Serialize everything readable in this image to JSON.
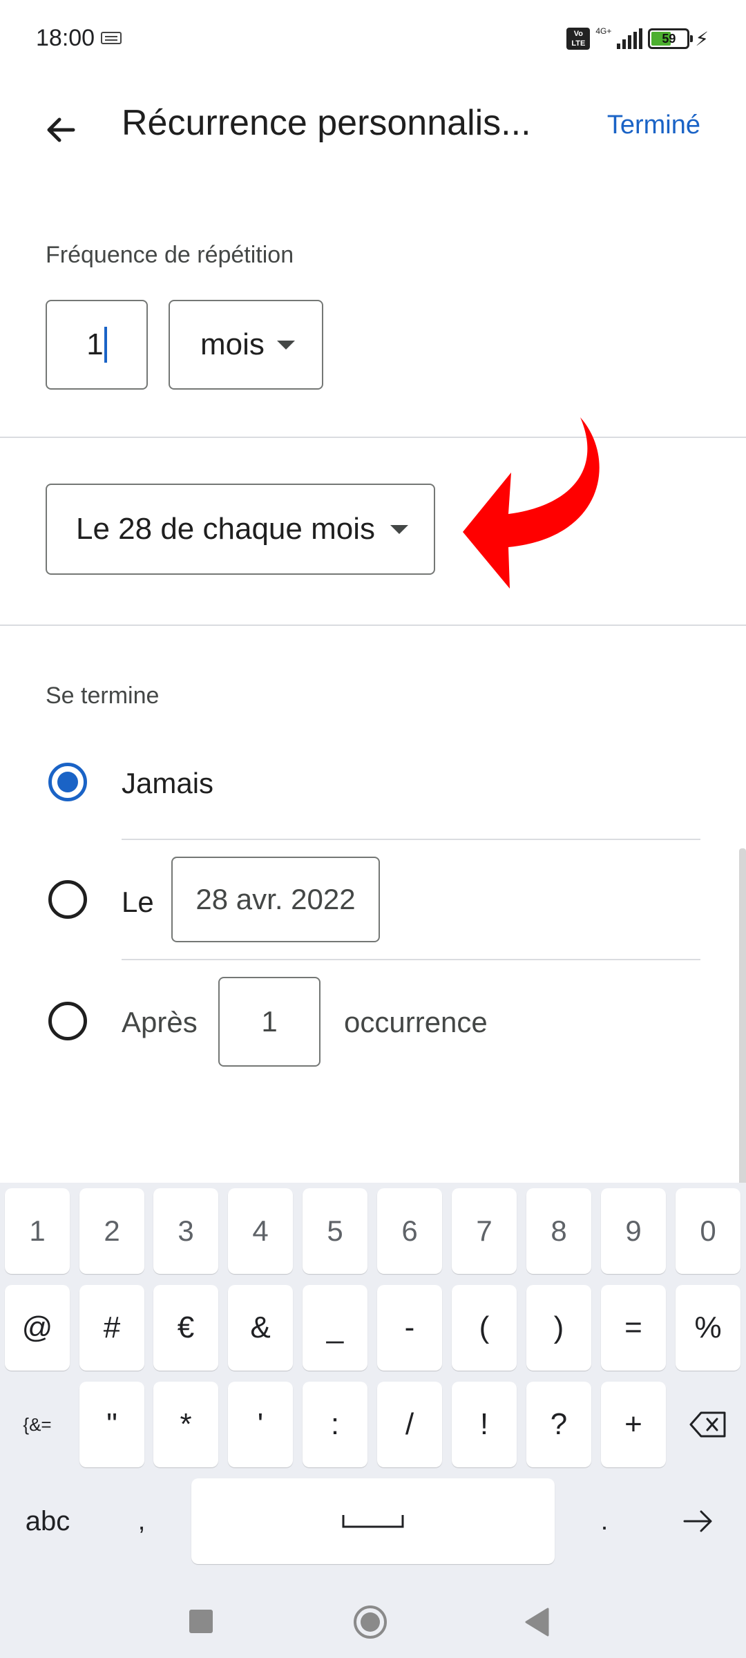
{
  "status_bar": {
    "time": "18:00",
    "volte": "Vo LTE",
    "network": "4G+",
    "battery": "59",
    "battery_level": 0.59,
    "icons": [
      "keyboard-icon",
      "volte-icon",
      "signal-icon",
      "battery-icon",
      "charging-bolt-icon"
    ]
  },
  "app_bar": {
    "title": "Récurrence personnalis...",
    "done_label": "Terminé",
    "back_icon": "arrow-left-icon"
  },
  "frequency": {
    "label": "Fréquence de répétition",
    "count_value": "1",
    "unit_value": "mois"
  },
  "monthly": {
    "selected": "Le 28 de chaque mois"
  },
  "annotation": {
    "arrow_color": "#ff0000"
  },
  "ends": {
    "label": "Se termine",
    "never_label": "Jamais",
    "on_label": "Le",
    "on_date": "28 avr. 2022",
    "after_label": "Après",
    "after_count": "1",
    "after_unit": "occurrence",
    "selected": "never"
  },
  "keyboard": {
    "row1": [
      "1",
      "2",
      "3",
      "4",
      "5",
      "6",
      "7",
      "8",
      "9",
      "0"
    ],
    "row2": [
      "@",
      "#",
      "€",
      "&",
      "_",
      "-",
      "(",
      ")",
      "=",
      "%"
    ],
    "row3_left": "{&=",
    "row3": [
      "\"",
      "*",
      "'",
      ":",
      "/",
      "!",
      "?",
      "+"
    ],
    "abc_label": "abc",
    "comma": ",",
    "period": "."
  },
  "colors": {
    "accent": "#1a63c6",
    "keyboard_bg": "#eceef3"
  }
}
